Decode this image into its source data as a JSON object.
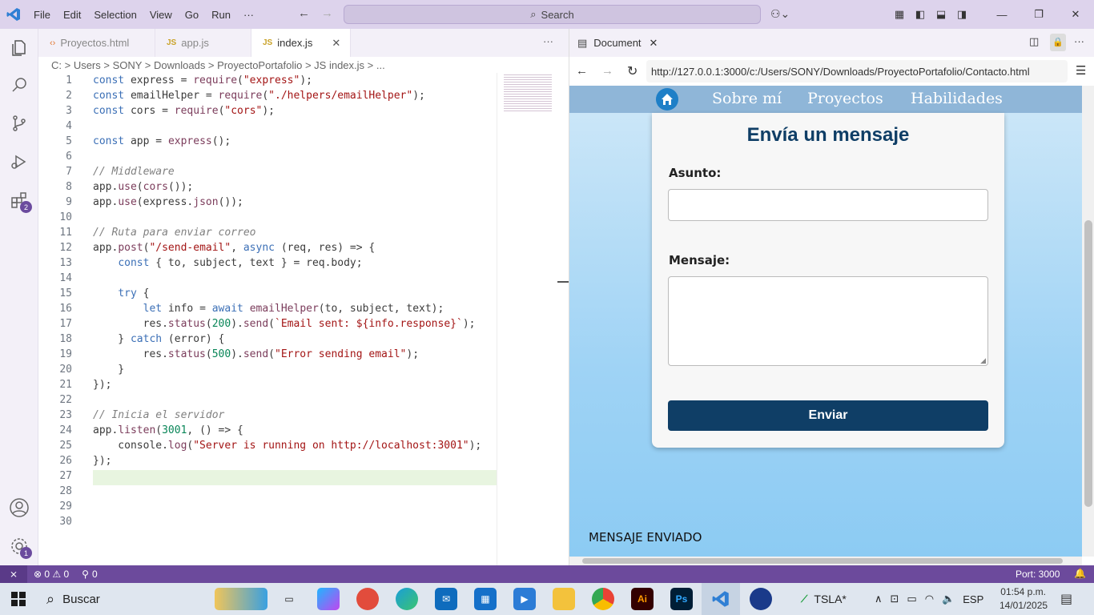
{
  "menu": [
    "File",
    "Edit",
    "Selection",
    "View",
    "Go",
    "Run",
    "···"
  ],
  "search": {
    "label": "Search"
  },
  "tabs": [
    {
      "label": "Proyectos.html",
      "icon": "html-icon"
    },
    {
      "label": "app.js",
      "icon": "js-icon"
    },
    {
      "label": "index.js",
      "icon": "js-icon"
    }
  ],
  "breadcrumb": "C: > Users > SONY > Downloads > ProyectoPortafolio > JS index.js > ...",
  "activity_badges": {
    "extensions": "2",
    "settings": "1"
  },
  "code_lines": [
    "const express = require(\"express\");",
    "const emailHelper = require(\"./helpers/emailHelper\");",
    "const cors = require(\"cors\");",
    "",
    "const app = express();",
    "",
    "// Middleware",
    "app.use(cors());",
    "app.use(express.json());",
    "",
    "// Ruta para enviar correo",
    "app.post(\"/send-email\", async (req, res) => {",
    "    const { to, subject, text } = req.body;",
    "",
    "    try {",
    "        let info = await emailHelper(to, subject, text);",
    "        res.status(200).send(`Email sent: ${info.response}`);",
    "    } catch (error) {",
    "        res.status(500).send(\"Error sending email\");",
    "    }",
    "});",
    "",
    "// Inicia el servidor",
    "app.listen(3001, () => {",
    "    console.log(\"Server is running on http://localhost:3001\");",
    "});",
    "",
    "",
    "",
    ""
  ],
  "browser": {
    "tab_title": "Document",
    "url": "http://127.0.0.1:3000/c:/Users/SONY/Downloads/ProyectoPortafolio/Contacto.html",
    "nav": [
      "Sobre mí",
      "Proyectos",
      "Habilidades"
    ],
    "form_title": "Envía un mensaje",
    "subject_label": "Asunto:",
    "message_label": "Mensaje:",
    "send_label": "Enviar",
    "result": "MENSAJE ENVIADO"
  },
  "status": {
    "problems": "⊗ 0 ⚠ 0",
    "ports": "0",
    "port": "Port: 3000"
  },
  "taskbar": {
    "search": "Buscar",
    "stock": "TSLA*",
    "lang": "ESP",
    "time": "01:54 p.m.",
    "date": "14/01/2025"
  }
}
